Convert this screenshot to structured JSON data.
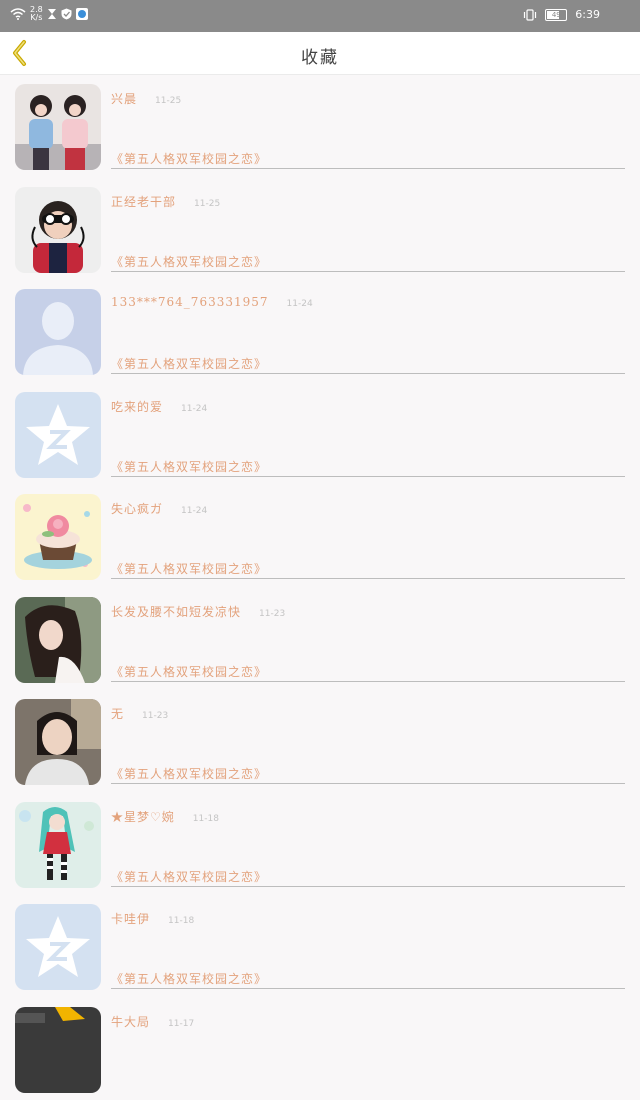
{
  "status_bar": {
    "speed_value": "2.8",
    "speed_unit": "K/s",
    "battery": "49",
    "time": "6:39",
    "icons": [
      "wifi-icon",
      "hourglass-icon",
      "shield-icon",
      "app-icon",
      "vibrate-icon",
      "battery-icon"
    ]
  },
  "header": {
    "title": "收藏",
    "back_icon": "chevron-left-icon",
    "accent": "#d8b900"
  },
  "colors": {
    "name_text": "#e3a27c",
    "date_text": "#c4c4c4",
    "divider": "#bdbdbd",
    "background": "#f9f7f8"
  },
  "items": [
    {
      "name": "兴晨",
      "date": "11-25",
      "work": "《第五人格双军校园之恋》",
      "avatar": "photo-two-girls"
    },
    {
      "name": "正经老干部",
      "date": "11-25",
      "work": "《第五人格双军校园之恋》",
      "avatar": "photo-boy-sunglasses"
    },
    {
      "name": "133***764_763331957",
      "date": "11-24",
      "work": "《第五人格双军校园之恋》",
      "avatar": "default-person"
    },
    {
      "name": "吃来的爱",
      "date": "11-24",
      "work": "《第五人格双军校园之恋》",
      "avatar": "qq-star"
    },
    {
      "name": "失心疯ガ",
      "date": "11-24",
      "work": "《第五人格双军校园之恋》",
      "avatar": "cupcake"
    },
    {
      "name": "长发及腰不如短发凉快",
      "date": "11-23",
      "work": "《第五人格双军校园之恋》",
      "avatar": "photo-long-hair-girl"
    },
    {
      "name": "无",
      "date": "11-23",
      "work": "《第五人格双军校园之恋》",
      "avatar": "photo-girl-selfie"
    },
    {
      "name": "★星梦&#x2661;婉",
      "date": "11-18",
      "work": "《第五人格双军校园之恋》",
      "avatar": "anime-girl"
    },
    {
      "name": "卡哇伊",
      "date": "11-18",
      "work": "《第五人格双军校园之恋》",
      "avatar": "qq-star"
    },
    {
      "name": "牛大局",
      "date": "11-17",
      "work": "",
      "avatar": "photo-partial"
    }
  ]
}
